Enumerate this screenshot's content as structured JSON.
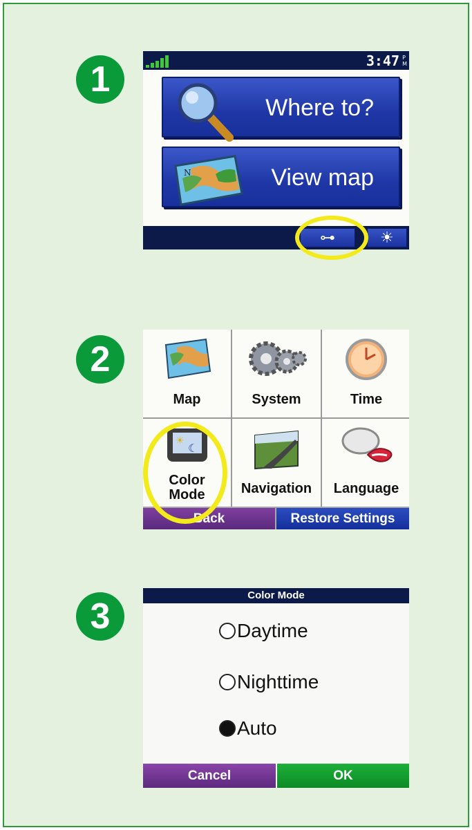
{
  "steps": [
    "1",
    "2",
    "3"
  ],
  "screen1": {
    "clock": "3:47",
    "ampm_top": "P",
    "ampm_bottom": "M",
    "buttons": [
      "Where to?",
      "View map"
    ],
    "tools_glyph": "⊶",
    "brightness_glyph": "☀"
  },
  "screen2": {
    "cells": [
      {
        "label": "Map",
        "icon": "map-icon"
      },
      {
        "label": "System",
        "icon": "gears-icon"
      },
      {
        "label": "Time",
        "icon": "clock-icon"
      },
      {
        "label_line1": "Color",
        "label_line2": "Mode",
        "icon": "color-mode-icon"
      },
      {
        "label": "Navigation",
        "icon": "road-icon"
      },
      {
        "label": "Language",
        "icon": "speech-bubble-icon"
      }
    ],
    "back": "Back",
    "restore": "Restore Settings"
  },
  "screen3": {
    "title": "Color Mode",
    "options": [
      {
        "label": "Daytime",
        "selected": false
      },
      {
        "label": "Nighttime",
        "selected": false
      },
      {
        "label": "Auto",
        "selected": true
      }
    ],
    "cancel": "Cancel",
    "ok": "OK"
  },
  "colors": {
    "panel_bg": "#e4f1df",
    "panel_border": "#2f9a3a",
    "step_badge": "#0b9a3a",
    "highlight_ring": "#f2ea1a",
    "blue_button": "#1f37a6",
    "purple_button": "#5a2a7c",
    "green_button": "#0c8a24"
  }
}
